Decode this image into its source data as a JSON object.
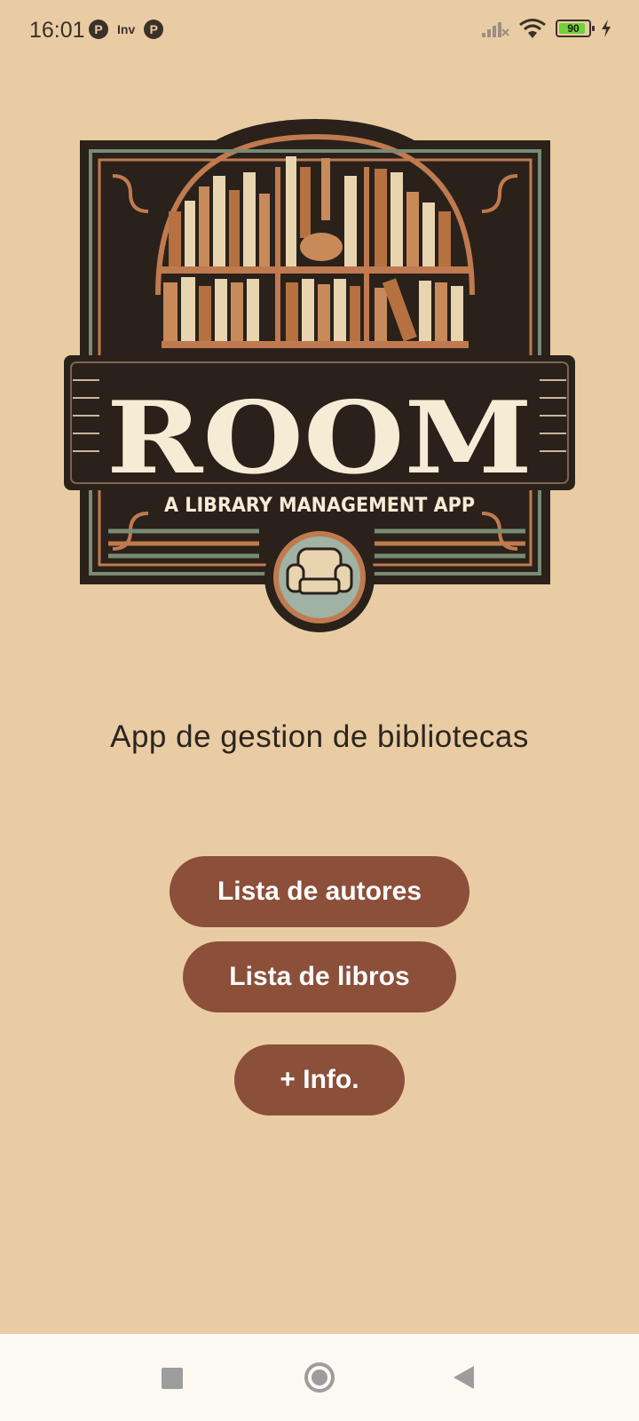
{
  "status_bar": {
    "time": "16:01",
    "notification_icons": [
      "p-icon",
      "inv-icon",
      "p-icon"
    ],
    "inv_label": "Inv",
    "battery_level": "90",
    "battery_percent": 90,
    "system_icons": [
      "signal-icon",
      "wifi-icon",
      "battery-icon",
      "charging-icon"
    ]
  },
  "logo": {
    "title": "ROOM",
    "subtitle": "A LIBRARY MANAGEMENT APP"
  },
  "main": {
    "tagline": "App de gestion de bibliotecas",
    "buttons": [
      {
        "label": "Lista de autores"
      },
      {
        "label": "Lista de libros"
      },
      {
        "label": "+ Info."
      }
    ]
  },
  "nav_bar": {
    "icons": [
      "recent-apps-icon",
      "home-icon",
      "back-icon"
    ]
  },
  "colors": {
    "background": "#e9cca3",
    "button": "#8b4f3a",
    "button_text": "#ffffff",
    "nav_bar": "#fcf9f3"
  }
}
